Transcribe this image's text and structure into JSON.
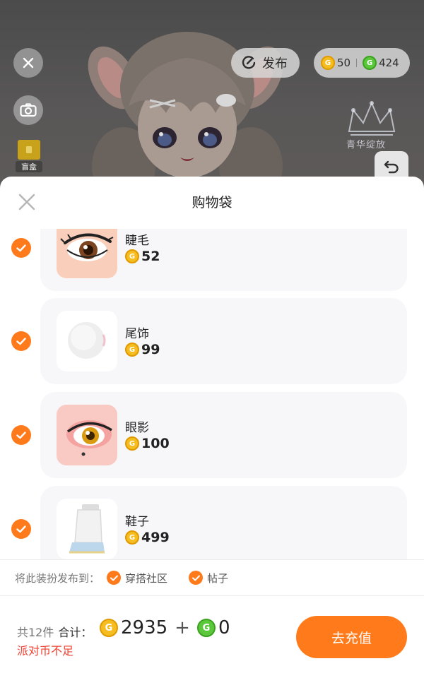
{
  "topbar": {
    "publish_label": "发布",
    "gold_coins": "50",
    "green_coins": "424",
    "blind_box_label": "盲盒",
    "crown_text": "青华绽放"
  },
  "sheet": {
    "title": "购物袋",
    "items": [
      {
        "name": "睫毛",
        "price": "52",
        "checked": true,
        "thumb": "eyelash"
      },
      {
        "name": "尾饰",
        "price": "99",
        "checked": true,
        "thumb": "tail"
      },
      {
        "name": "眼影",
        "price": "100",
        "checked": true,
        "thumb": "eyeshadow"
      },
      {
        "name": "鞋子",
        "price": "499",
        "checked": true,
        "thumb": "shoes"
      }
    ],
    "publish_to": {
      "label": "将此装扮发布到：",
      "options": [
        "穿搭社区",
        "帖子"
      ]
    }
  },
  "footer": {
    "count": "共12件",
    "total_label": "合计：",
    "gold_total": "2935",
    "plus": "+",
    "green_total": "0",
    "warning": "派对币不足",
    "recharge_label": "去充值"
  },
  "colors": {
    "accent": "#ff7a1a",
    "warning": "#f0402f",
    "gold_coin": "#f5bd1f",
    "green_coin": "#5ac83a"
  }
}
